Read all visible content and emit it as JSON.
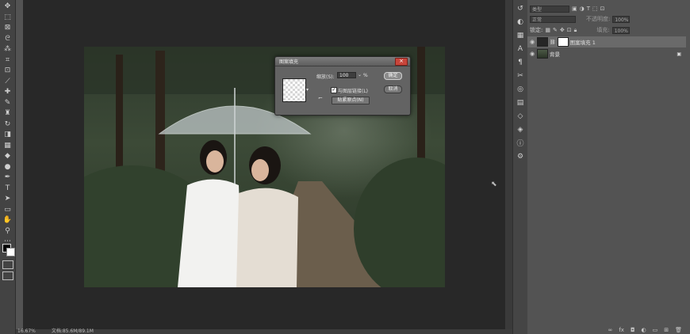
{
  "toolbar": {
    "tools": [
      {
        "name": "move-tool-icon",
        "glyph": "✥"
      },
      {
        "name": "marquee-tool-icon",
        "glyph": "⬚"
      },
      {
        "name": "artboard-tool-icon",
        "glyph": "⊠"
      },
      {
        "name": "lasso-tool-icon",
        "glyph": "ᘓ"
      },
      {
        "name": "magic-wand-tool-icon",
        "glyph": "⁂"
      },
      {
        "name": "crop-tool-icon",
        "glyph": "⌗"
      },
      {
        "name": "frame-tool-icon",
        "glyph": "⊡"
      },
      {
        "name": "eyedropper-tool-icon",
        "glyph": "⟋"
      },
      {
        "name": "healing-brush-tool-icon",
        "glyph": "✚"
      },
      {
        "name": "brush-tool-icon",
        "glyph": "✎"
      },
      {
        "name": "clone-stamp-tool-icon",
        "glyph": "♜"
      },
      {
        "name": "history-brush-tool-icon",
        "glyph": "↻"
      },
      {
        "name": "eraser-tool-icon",
        "glyph": "◨"
      },
      {
        "name": "gradient-tool-icon",
        "glyph": "▦"
      },
      {
        "name": "blur-tool-icon",
        "glyph": "◆"
      },
      {
        "name": "dodge-tool-icon",
        "glyph": "●"
      },
      {
        "name": "pen-tool-icon",
        "glyph": "✒"
      },
      {
        "name": "type-tool-icon",
        "glyph": "T"
      },
      {
        "name": "path-selection-tool-icon",
        "glyph": "➤"
      },
      {
        "name": "rectangle-tool-icon",
        "glyph": "▭"
      },
      {
        "name": "hand-tool-icon",
        "glyph": "✋"
      },
      {
        "name": "zoom-tool-icon",
        "glyph": "⚲"
      },
      {
        "name": "more-tools-icon",
        "glyph": "⋯"
      }
    ]
  },
  "statusbar": {
    "zoom": "16.67%",
    "doc_size": "文档:85.6M/89.1M"
  },
  "layers_panel": {
    "kind_filter": "类型",
    "blend_mode": "正常",
    "opacity_label": "不透明度:",
    "opacity_value": "100%",
    "lock_label": "锁定:",
    "fill_label": "填充:",
    "fill_value": "100%",
    "layers": [
      {
        "name": "图案填充 1",
        "selected": true
      },
      {
        "name": "背景",
        "selected": false
      }
    ],
    "bottom_icons": [
      "link-layers-icon",
      "fx-icon",
      "add-mask-icon",
      "adjustment-layer-icon",
      "group-icon",
      "new-layer-icon",
      "delete-layer-icon"
    ]
  },
  "pattern_fill_dialog": {
    "title": "图案填充",
    "scale_label": "缩放(S):",
    "scale_value": "100",
    "percent": "%",
    "link_label": "与图层链接(L)",
    "link_checked": true,
    "ok": "确定",
    "cancel": "取消",
    "snap_to_origin": "贴紧原点(N)"
  },
  "icon_strip": [
    {
      "name": "history-panel-icon",
      "glyph": "↺"
    },
    {
      "name": "color-panel-icon",
      "glyph": "◐"
    },
    {
      "name": "swatches-panel-icon",
      "glyph": "▦"
    },
    {
      "name": "character-panel-icon",
      "glyph": "A"
    },
    {
      "name": "paragraph-panel-icon",
      "glyph": "¶"
    },
    {
      "name": "tools-panel-icon",
      "glyph": "✂"
    },
    {
      "name": "adjustments-panel-icon",
      "glyph": "◎"
    },
    {
      "name": "channels-panel-icon",
      "glyph": "▤"
    },
    {
      "name": "paths-panel-icon",
      "glyph": "◇"
    },
    {
      "name": "layers-panel-icon",
      "glyph": "◈"
    },
    {
      "name": "info-panel-icon",
      "glyph": "ⓘ"
    },
    {
      "name": "properties-panel-icon",
      "glyph": "⚙"
    }
  ]
}
